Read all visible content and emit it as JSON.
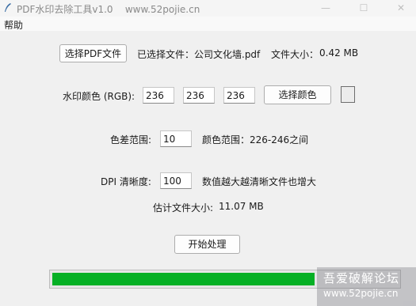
{
  "window": {
    "title": "PDF水印去除工具v1.0",
    "subtitle": "www.52pojie.cn",
    "minimize_glyph": "—",
    "maximize_glyph": "☐",
    "close_glyph": "✕",
    "icon": "feather-icon"
  },
  "menu": {
    "items": [
      {
        "label": "帮助"
      }
    ]
  },
  "file": {
    "select_button": "选择PDF文件",
    "selected_label": "已选择文件：",
    "selected_name": "公司文化墙.pdf",
    "size_label": "文件大小：",
    "size_value": "0.42 MB"
  },
  "watermark_color": {
    "label": "水印颜色 (RGB):",
    "r": "236",
    "g": "236",
    "b": "236",
    "pick_button": "选择颜色",
    "swatch_color": "#ececec"
  },
  "tolerance": {
    "label": "色差范围:",
    "value": "10",
    "range_label": "颜色范围：",
    "range_value": "226-246之间"
  },
  "dpi": {
    "label": "DPI 清晰度:",
    "value": "100",
    "hint": "数值越大越清晰文件也增大"
  },
  "estimate": {
    "label": "估计文件大小:",
    "value": "11.07 MB"
  },
  "actions": {
    "start_button": "开始处理"
  },
  "progress": {
    "fraction": 0.76,
    "color": "#06b025"
  },
  "site_watermark": {
    "line1": "吾爱破解论坛",
    "line2": "www.52pojie.cn"
  }
}
